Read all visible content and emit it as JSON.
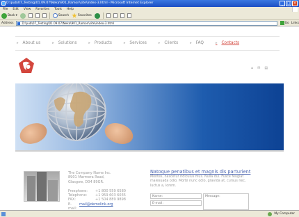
{
  "window": {
    "title": "D:\\pub\\07_Testing\\01.09.07\\Neka\\901_Ramon\\site\\index-3.html - Microsoft Internet Explorer"
  },
  "menu": [
    "File",
    "Edit",
    "View",
    "Favorites",
    "Tools",
    "Help"
  ],
  "toolbar": {
    "back_label": "Back",
    "search_label": "Search",
    "favorites_label": "Favorites"
  },
  "address": {
    "label": "Address",
    "value": "D:\\pub\\07_Testing\\01.09.07\\Neka\\901_Ramon\\site\\index-3.html",
    "go_label": "Go",
    "links_label": "Links"
  },
  "status": {
    "zone": "My Computer"
  },
  "site": {
    "nav": [
      {
        "label": "About us",
        "active": false
      },
      {
        "label": "Solutions",
        "active": false
      },
      {
        "label": "Products",
        "active": false
      },
      {
        "label": "Services",
        "active": false
      },
      {
        "label": "Clients",
        "active": false
      },
      {
        "label": "FAQ",
        "active": false
      },
      {
        "label": "Contacts",
        "active": true
      }
    ],
    "tools": [
      "⌂",
      "✉",
      "▤"
    ],
    "company": {
      "name": "The Company Name Inc.",
      "address1": "8901 Marmora Road,",
      "address2": "Glasgow, D04 89GR.",
      "freephone_label": "Freephone:",
      "freephone": "+1 800 559 6580",
      "telephone_label": "Telephone:",
      "telephone": "+1 959 603 6035",
      "fax_label": "FAX:",
      "fax": "+1 504 889 9898",
      "email_label": "E-mail:",
      "email": "mail@demolink.org"
    },
    "form": {
      "title": "Natoque penatibus et magnis dis parturient",
      "text": "Montes, nascetur ridiculus mus. Nulla dui. Fusce feugiat malesuada odio. Morbi nunc odio, gravida at, cursus nec, luctus a, lorem.",
      "name_placeholder": "Name:",
      "email_placeholder": "E-mail:",
      "message_placeholder": "Message:"
    }
  },
  "colors": {
    "accent": "#d3463d",
    "link": "#4a64b0",
    "banner_dark": "#0d4294",
    "banner_light": "#cfe0f4"
  }
}
